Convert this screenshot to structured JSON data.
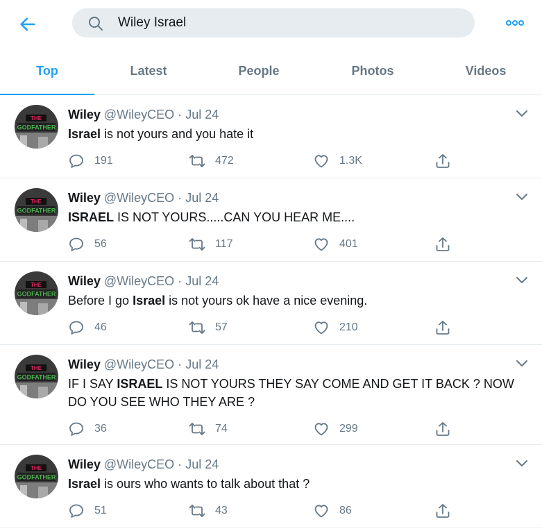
{
  "search": {
    "query": "Wiley Israel"
  },
  "tabs": [
    {
      "label": "Top"
    },
    {
      "label": "Latest"
    },
    {
      "label": "People"
    },
    {
      "label": "Photos"
    },
    {
      "label": "Videos"
    }
  ],
  "colors": {
    "accent": "#1da1f2",
    "muted": "#657786",
    "border": "#e6ecf0"
  },
  "tweets": [
    {
      "name": "Wiley",
      "handle": "@WileyCEO",
      "sep": "·",
      "date": "Jul 24",
      "text_bold": "Israel",
      "text_rest": " is not yours and you hate it",
      "text_pre": "",
      "text_line2": "",
      "replies": "191",
      "retweets": "472",
      "likes": "1.3K"
    },
    {
      "name": "Wiley",
      "handle": "@WileyCEO",
      "sep": "·",
      "date": "Jul 24",
      "text_pre": "",
      "text_bold": "ISRAEL",
      "text_rest": " IS NOT YOURS.....CAN YOU HEAR ME....",
      "text_line2": "",
      "replies": "56",
      "retweets": "117",
      "likes": "401"
    },
    {
      "name": "Wiley",
      "handle": "@WileyCEO",
      "sep": "·",
      "date": "Jul 24",
      "text_pre": "Before I go ",
      "text_bold": "Israel",
      "text_rest": " is not yours ok have a nice evening.",
      "text_line2": "",
      "replies": "46",
      "retweets": "57",
      "likes": "210"
    },
    {
      "name": "Wiley",
      "handle": "@WileyCEO",
      "sep": "·",
      "date": "Jul 24",
      "text_pre": "IF I SAY ",
      "text_bold": "ISRAEL",
      "text_rest": " IS NOT YOURS THEY SAY COME AND GET IT BACK ? NOW",
      "text_line2": "DO YOU SEE WHO THEY ARE ?",
      "replies": "36",
      "retweets": "74",
      "likes": "299"
    },
    {
      "name": "Wiley",
      "handle": "@WileyCEO",
      "sep": "·",
      "date": "Jul 24",
      "text_pre": "",
      "text_bold": "Israel",
      "text_rest": " is ours who wants to talk about that ?",
      "text_line2": "",
      "replies": "51",
      "retweets": "43",
      "likes": "86"
    }
  ]
}
